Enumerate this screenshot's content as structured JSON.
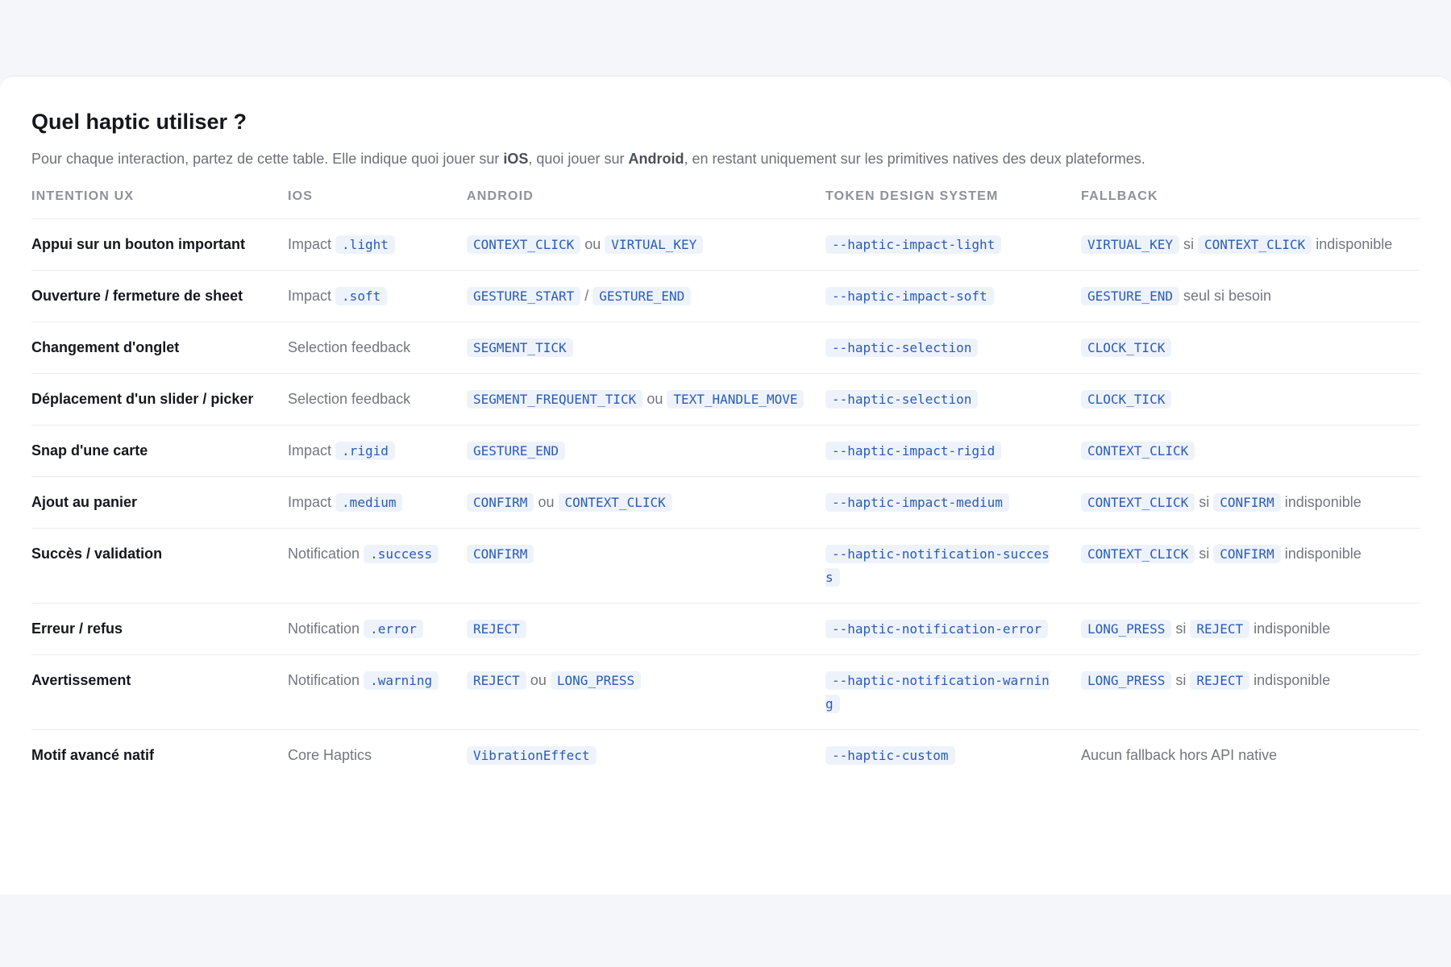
{
  "header": {
    "title": "Quel haptic utiliser ?",
    "subtitle_part1": "Pour chaque interaction, partez de cette table. Elle indique quoi jouer sur ",
    "subtitle_ios": "iOS",
    "subtitle_part2": ", quoi jouer sur ",
    "subtitle_android": "Android",
    "subtitle_part3": ", en restant uniquement sur les primitives natives des deux plateformes."
  },
  "table": {
    "columns": [
      "Intention UX",
      "iOS",
      "Android",
      "Token design system",
      "Fallback"
    ],
    "rows": [
      {
        "intent": "Appui sur un bouton important",
        "ios_text": "Impact",
        "ios_code": ".light",
        "android_a": "CONTEXT_CLICK",
        "android_sep": "ou",
        "android_b": "VIRTUAL_KEY",
        "token": "--haptic-impact-light",
        "fallback_a": "VIRTUAL_KEY",
        "fallback_sep": "si",
        "fallback_b": "CONTEXT_CLICK",
        "fallback_tail": "indisponible"
      },
      {
        "intent": "Ouverture / fermeture de sheet",
        "ios_text": "Impact",
        "ios_code": ".soft",
        "android_a": "GESTURE_START",
        "android_sep": "/",
        "android_b": "GESTURE_END",
        "token": "--haptic-impact-soft",
        "fallback_a": "GESTURE_END",
        "fallback_tail": "seul si besoin"
      },
      {
        "intent": "Changement d'onglet",
        "ios_text": "Selection feedback",
        "android_a": "SEGMENT_TICK",
        "token": "--haptic-selection",
        "fallback_a": "CLOCK_TICK"
      },
      {
        "intent": "Déplacement d'un slider / picker",
        "ios_text": "Selection feedback",
        "android_a": "SEGMENT_FREQUENT_TICK",
        "android_sep": "ou",
        "android_b": "TEXT_HANDLE_MOVE",
        "token": "--haptic-selection",
        "fallback_a": "CLOCK_TICK"
      },
      {
        "intent": "Snap d'une carte",
        "ios_text": "Impact",
        "ios_code": ".rigid",
        "android_a": "GESTURE_END",
        "token": "--haptic-impact-rigid",
        "fallback_a": "CONTEXT_CLICK"
      },
      {
        "intent": "Ajout au panier",
        "ios_text": "Impact",
        "ios_code": ".medium",
        "android_a": "CONFIRM",
        "android_sep": "ou",
        "android_b": "CONTEXT_CLICK",
        "token": "--haptic-impact-medium",
        "fallback_a": "CONTEXT_CLICK",
        "fallback_sep": "si",
        "fallback_b": "CONFIRM",
        "fallback_tail": "indisponible"
      },
      {
        "intent": "Succès / validation",
        "ios_text": "Notification",
        "ios_code": ".success",
        "android_a": "CONFIRM",
        "token": "--haptic-notification-success",
        "fallback_a": "CONTEXT_CLICK",
        "fallback_sep": "si",
        "fallback_b": "CONFIRM",
        "fallback_tail": "indisponible"
      },
      {
        "intent": "Erreur / refus",
        "ios_text": "Notification",
        "ios_code": ".error",
        "android_a": "REJECT",
        "token": "--haptic-notification-error",
        "fallback_a": "LONG_PRESS",
        "fallback_sep": "si",
        "fallback_b": "REJECT",
        "fallback_tail": "indisponible"
      },
      {
        "intent": "Avertissement",
        "ios_text": "Notification",
        "ios_code": ".warning",
        "android_a": "REJECT",
        "android_sep": "ou",
        "android_b": "LONG_PRESS",
        "token": "--haptic-notification-warning",
        "fallback_a": "LONG_PRESS",
        "fallback_sep": "si",
        "fallback_b": "REJECT",
        "fallback_tail": "indisponible"
      },
      {
        "intent": "Motif avancé natif",
        "ios_text": "Core Haptics",
        "android_a": "VibrationEffect",
        "token": "--haptic-custom",
        "fallback_plain": "Aucun fallback hors API native"
      }
    ]
  }
}
